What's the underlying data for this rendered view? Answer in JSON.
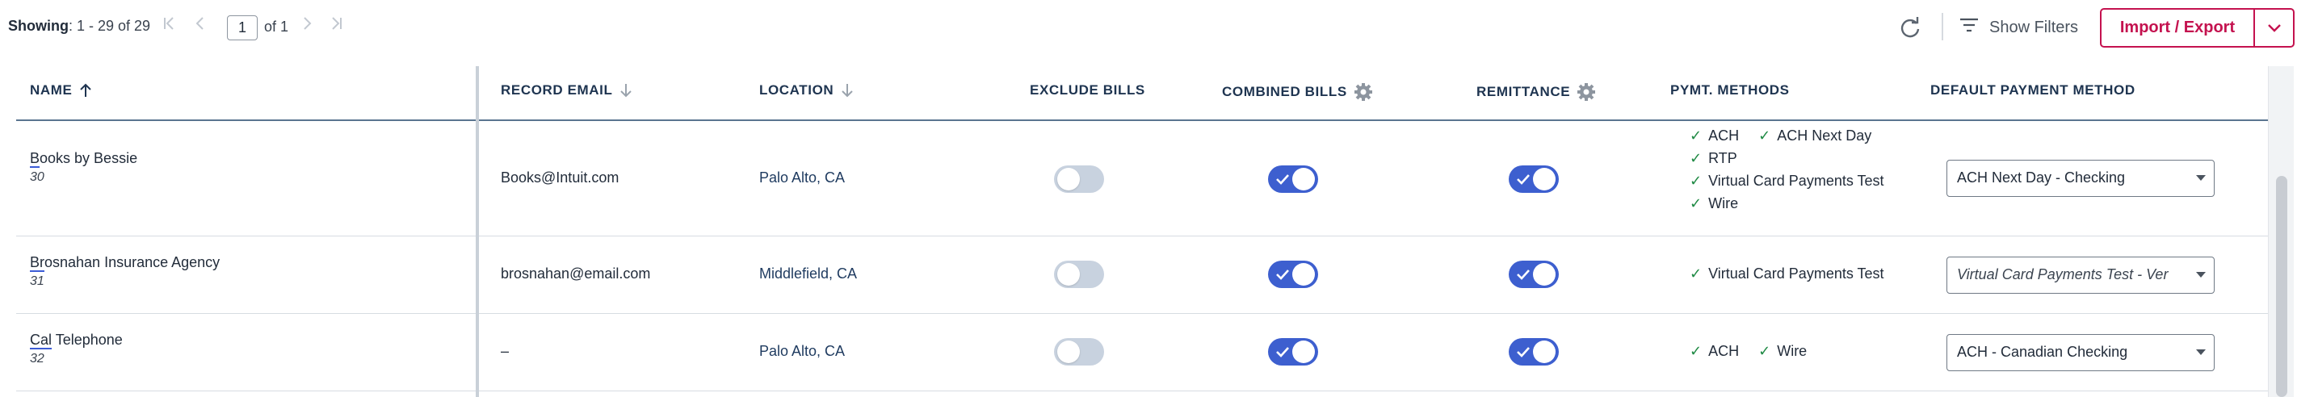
{
  "pagination": {
    "showing_label": "Showing",
    "showing_range": ": 1 - 29 of 29",
    "page_value": "1",
    "of_label": "of 1"
  },
  "toolbar": {
    "show_filters": "Show Filters",
    "import_export": "Import / Export"
  },
  "table": {
    "headers": {
      "name": "NAME",
      "record_email": "RECORD EMAIL",
      "location": "LOCATION",
      "exclude_bills": "EXCLUDE BILLS",
      "combined_bills": "COMBINED BILLS",
      "remittance": "REMITTANCE",
      "pymt_methods": "PYMT. METHODS",
      "default_payment_method": "DEFAULT PAYMENT METHOD"
    },
    "rows": [
      {
        "name_first": "B",
        "name_rest": "ooks by Bessie",
        "id": "30",
        "email": "Books@Intuit.com",
        "location": "Palo Alto, CA",
        "exclude_bills": false,
        "combined_bills": true,
        "remittance": true,
        "methods": [
          [
            "ACH",
            "ACH Next Day"
          ],
          [
            "RTP"
          ],
          [
            "Virtual Card Payments Test"
          ],
          [
            "Wire"
          ]
        ],
        "default_method": "ACH Next Day - Checking"
      },
      {
        "name_first": "Br",
        "name_rest": "osnahan Insurance Agency",
        "id": "31",
        "email": "brosnahan@email.com",
        "location": "Middlefield, CA",
        "exclude_bills": false,
        "combined_bills": true,
        "remittance": true,
        "methods": [
          [
            "Virtual Card Payments Test"
          ]
        ],
        "default_method": "Virtual Card Payments Test - Ver"
      },
      {
        "name_first": "Cal",
        "name_rest": " Telephone",
        "id": "32",
        "email": "–",
        "location": "Palo Alto, CA",
        "exclude_bills": false,
        "combined_bills": true,
        "remittance": true,
        "methods": [
          [
            "ACH",
            "Wire"
          ]
        ],
        "default_method": "ACH - Canadian Checking"
      }
    ]
  },
  "icons": {
    "first_page": "first-page-icon",
    "prev_page": "prev-page-icon",
    "next_page": "next-page-icon",
    "last_page": "last-page-icon",
    "refresh": "refresh-icon",
    "filter": "filter-icon",
    "settings": "gear-icon",
    "sort_asc": "arrow-up-icon",
    "sort_desc": "arrow-down-icon"
  },
  "colors": {
    "accent": "#c4124f",
    "toggle_on": "#3d5fcf",
    "toggle_off": "#c8d2df",
    "check_green": "#1f8a44",
    "header_text": "#1e3450"
  }
}
